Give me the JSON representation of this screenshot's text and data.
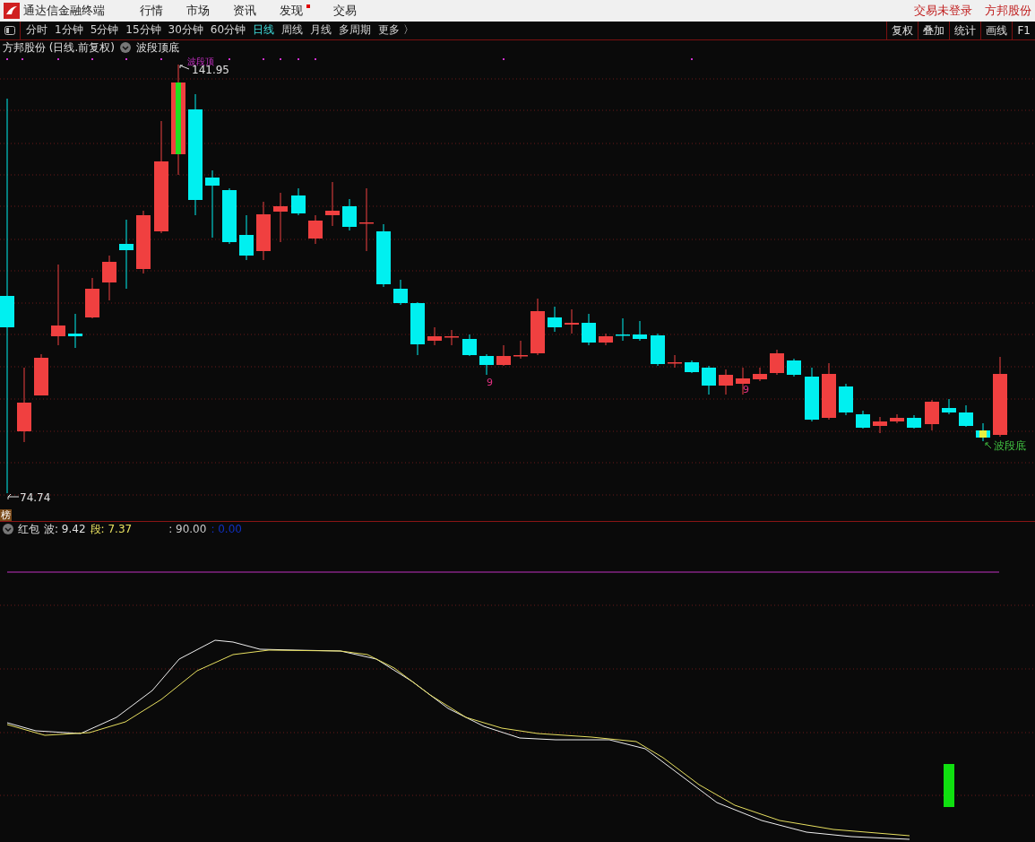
{
  "app": {
    "title": "通达信金融终端",
    "menu": [
      {
        "label": "行情",
        "badge": false
      },
      {
        "label": "市场",
        "badge": false
      },
      {
        "label": "资讯",
        "badge": false
      },
      {
        "label": "发现",
        "badge": true
      },
      {
        "label": "交易",
        "badge": false
      }
    ],
    "account": [
      "交易未登录",
      "方邦股份"
    ]
  },
  "periods": [
    {
      "label": "分时",
      "selected": false
    },
    {
      "label": "1分钟",
      "selected": false
    },
    {
      "label": "5分钟",
      "selected": false
    },
    {
      "label": "15分钟",
      "selected": false
    },
    {
      "label": "30分钟",
      "selected": false
    },
    {
      "label": "60分钟",
      "selected": false
    },
    {
      "label": "日线",
      "selected": true
    },
    {
      "label": "周线",
      "selected": false
    },
    {
      "label": "月线",
      "selected": false
    },
    {
      "label": "多周期",
      "selected": false
    },
    {
      "label": "更多 〉",
      "selected": false
    }
  ],
  "tools": [
    "复权",
    "叠加",
    "统计",
    "画线",
    "F1"
  ],
  "chart": {
    "title": "方邦股份 (日线.前复权)",
    "indicator": "波段顶底",
    "top_marker": "波段顶",
    "high_label": "141.95",
    "low_label": "74.74",
    "bottom_marker": "波段底",
    "counts": [
      "9",
      "9"
    ],
    "tag": "榜"
  },
  "indicator": {
    "name": "红包",
    "values": [
      {
        "label": "波: 9.42",
        "color": "#e0e0e0"
      },
      {
        "label": "段: 7.37",
        "color": "#e8e060"
      },
      {
        "label": ": 90.00",
        "color": "#c8c8c8"
      },
      {
        "label": ": 0.00",
        "color": "#1030c0"
      }
    ]
  }
}
